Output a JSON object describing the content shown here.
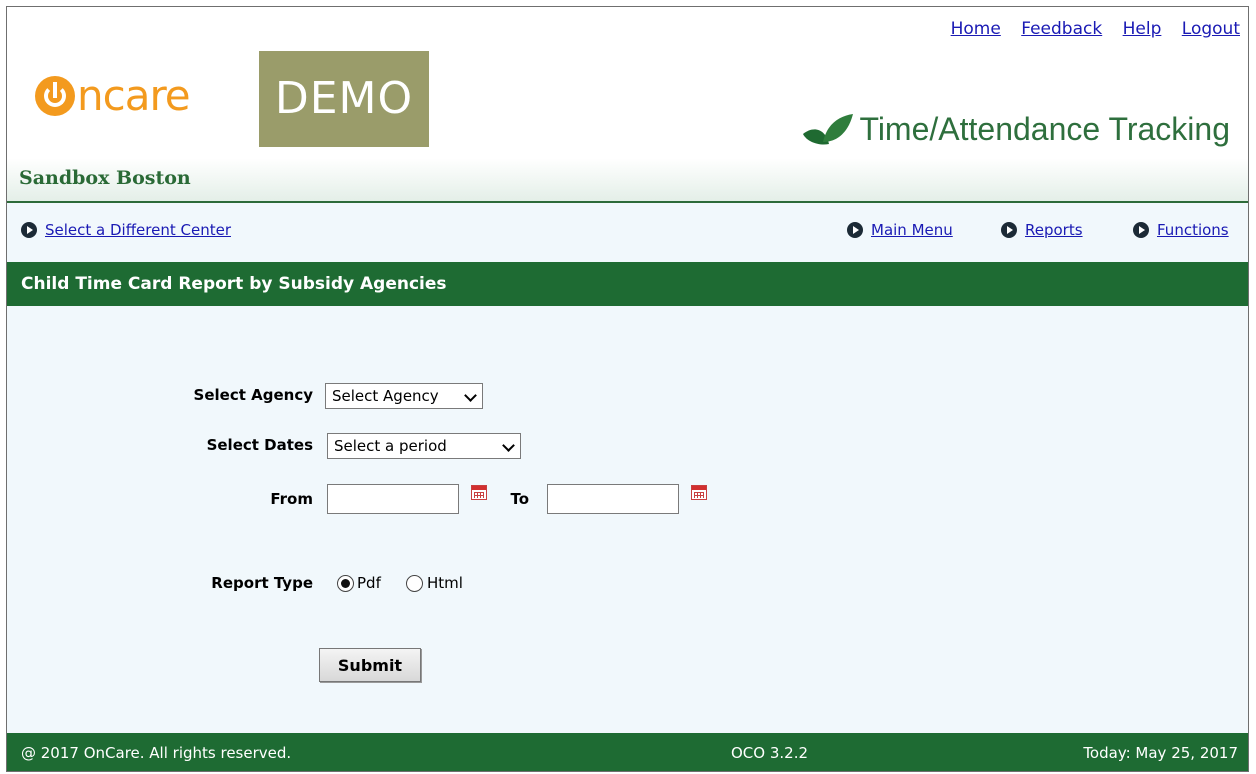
{
  "top_links": [
    "Home",
    "Feedback",
    "Help",
    "Logout"
  ],
  "logo": {
    "brand": "Oncare",
    "badge": "DEMO"
  },
  "product_title": "Time/Attendance Tracking",
  "center_name": "Sandbox Boston",
  "nav": {
    "select_center": "Select a Different Center",
    "main_menu": "Main Menu",
    "reports": "Reports",
    "functions": "Functions"
  },
  "page_title": "Child Time Card Report by Subsidy Agencies",
  "form": {
    "agency_label": "Select Agency",
    "agency_value": "Select Agency",
    "dates_label": "Select Dates",
    "dates_value": "Select a period",
    "from_label": "From",
    "from_value": "",
    "to_label": "To",
    "to_value": "",
    "report_type_label": "Report Type",
    "report_types": [
      "Pdf",
      "Html"
    ],
    "report_type_selected": "Pdf",
    "submit_label": "Submit"
  },
  "footer": {
    "copyright": "@ 2017 OnCare. All rights reserved.",
    "version": "OCO 3.2.2",
    "today": "Today: May 25, 2017"
  },
  "colors": {
    "brand_green": "#1e6b33",
    "link_blue": "#1a1ab4",
    "logo_orange": "#f39a1e",
    "demo_olive": "#9a9c6a"
  }
}
